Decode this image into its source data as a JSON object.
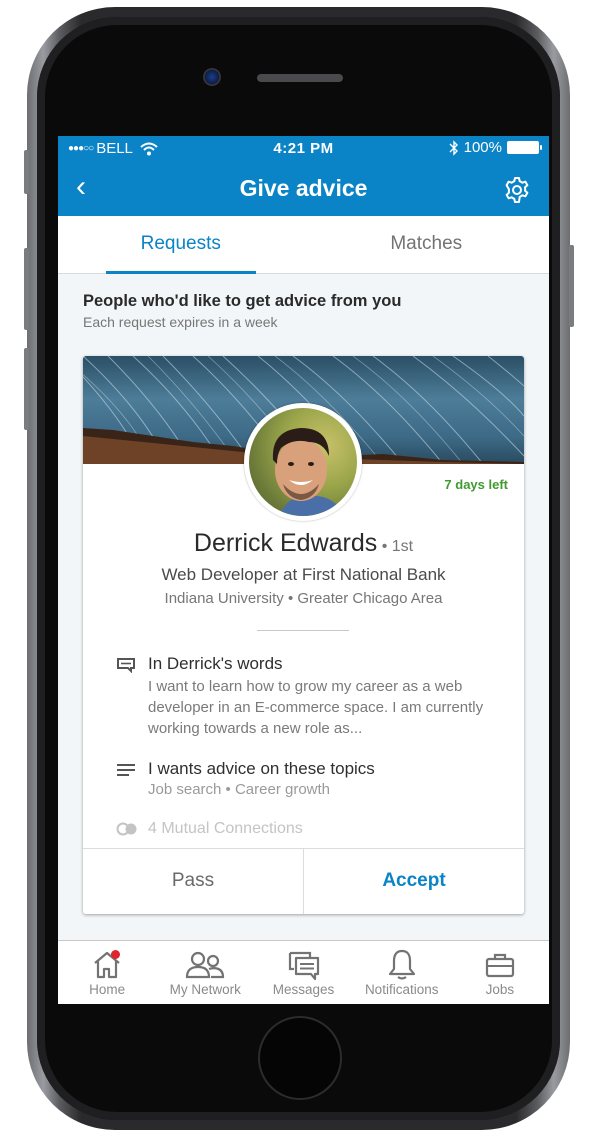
{
  "device": {
    "type": "phone-mockup"
  },
  "status_bar": {
    "carrier": "BELL",
    "signal": "●●●○○",
    "time": "4:21 PM",
    "battery": "100%",
    "icons": [
      "wifi-icon",
      "bluetooth-icon",
      "battery-icon"
    ]
  },
  "nav_bar": {
    "title": "Give advice",
    "back_icon": "chevron-left-icon",
    "settings_icon": "gear-icon",
    "back_glyph": "‹"
  },
  "tabs": [
    {
      "label": "Requests",
      "active": true
    },
    {
      "label": "Matches",
      "active": false
    }
  ],
  "section": {
    "title": "People who'd like to get advice from you",
    "subtitle": "Each request expires in a week"
  },
  "request_card": {
    "days_left": "7 days left",
    "name": "Derrick Edwards",
    "degree": " • 1st",
    "headline": "Web Developer at First National Bank",
    "meta": "Indiana University  •  Greater Chicago Area",
    "words": {
      "title": "In Derrick's words",
      "body": "I want to learn how to grow my career as a web developer in an E-commerce space. I am currently working towards a new role as..."
    },
    "topics": {
      "title": "I wants advice on these topics",
      "body": "Job search  •  Career growth"
    },
    "mutual": "4 Mutual Connections",
    "pass_label": "Pass",
    "accept_label": "Accept"
  },
  "bottom_nav": [
    {
      "label": "Home",
      "icon": "home-icon",
      "badge": true
    },
    {
      "label": "My Network",
      "icon": "people-icon",
      "badge": false
    },
    {
      "label": "Messages",
      "icon": "messages-icon",
      "badge": false
    },
    {
      "label": "Notifications",
      "icon": "bell-icon",
      "badge": false
    },
    {
      "label": "Jobs",
      "icon": "briefcase-icon",
      "badge": false
    }
  ],
  "colors": {
    "brand_blue": "#0a84c6",
    "days_left_green": "#3f9b30",
    "badge_red": "#e0232c",
    "background": "#f3f6f8"
  }
}
